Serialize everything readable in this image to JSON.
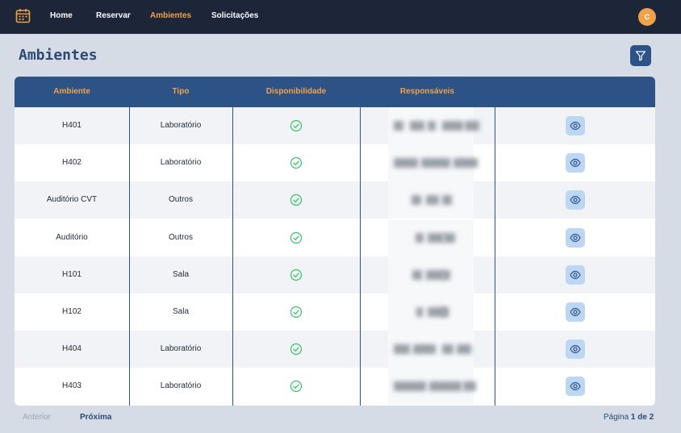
{
  "nav": {
    "items": [
      {
        "label": "Home",
        "active": false
      },
      {
        "label": "Reservar",
        "active": false
      },
      {
        "label": "Ambientes",
        "active": true
      },
      {
        "label": "Solicitações",
        "active": false
      }
    ],
    "avatar_initial": "C",
    "logo_icon": "calendar-icon"
  },
  "page": {
    "title": "Ambientes",
    "filter_icon": "filter-icon"
  },
  "table": {
    "columns": [
      "Ambiente",
      "Tipo",
      "Disponibilidade",
      "Responsáveis",
      ""
    ],
    "rows": [
      {
        "ambiente": "H401",
        "tipo": "Laboratório",
        "disponivel": true
      },
      {
        "ambiente": "H402",
        "tipo": "Laboratório",
        "disponivel": true
      },
      {
        "ambiente": "Auditório CVT",
        "tipo": "Outros",
        "disponivel": true
      },
      {
        "ambiente": "Auditório",
        "tipo": "Outros",
        "disponivel": true
      },
      {
        "ambiente": "H101",
        "tipo": "Sala",
        "disponivel": true
      },
      {
        "ambiente": "H102",
        "tipo": "Sala",
        "disponivel": true
      },
      {
        "ambiente": "H404",
        "tipo": "Laboratório",
        "disponivel": true
      },
      {
        "ambiente": "H403",
        "tipo": "Laboratório",
        "disponivel": true
      }
    ]
  },
  "pagination": {
    "prev_label": "Anterior",
    "next_label": "Próxima",
    "page_prefix": "Página",
    "page_current": "1 de 2"
  },
  "colors": {
    "nav_bg": "#1c2638",
    "accent": "#f0a24a",
    "header_bg": "#2d5286",
    "available": "#34c26b",
    "page_bg": "#d5dce6"
  }
}
